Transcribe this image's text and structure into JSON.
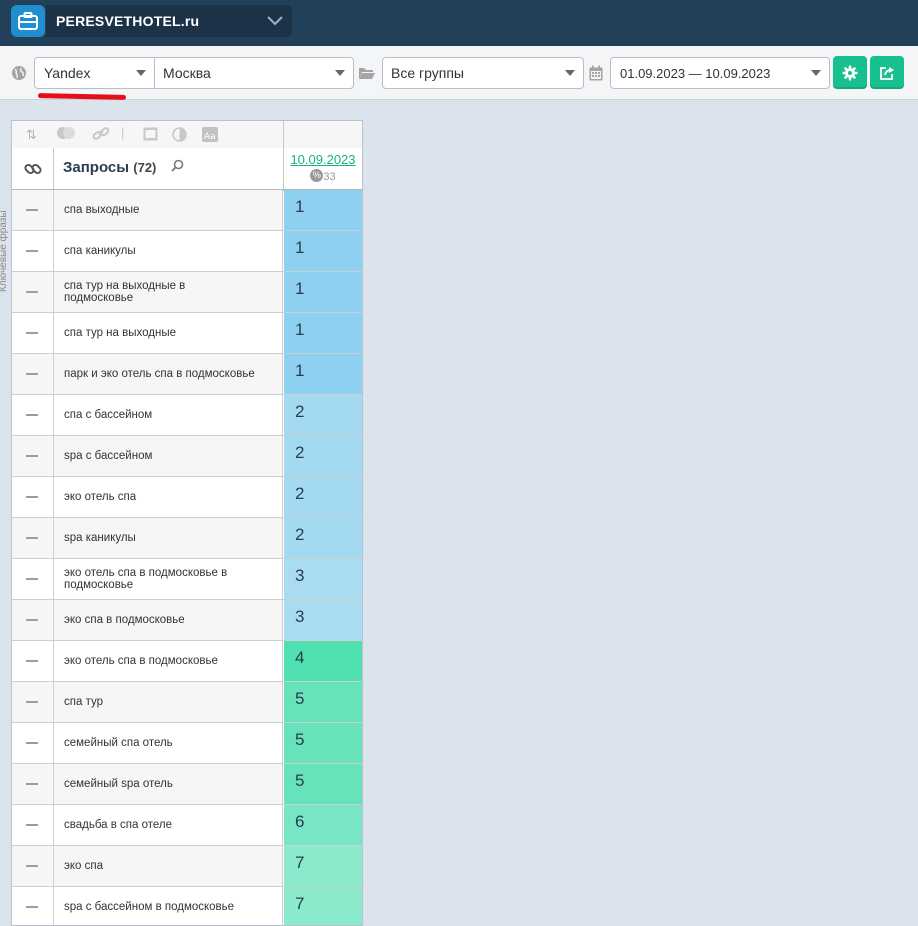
{
  "header": {
    "project_name": "PERESVETHOTEL.ru"
  },
  "filters": {
    "engine": "Yandex",
    "city": "Москва",
    "group": "Все группы",
    "date_range": "01.09.2023 — 10.09.2023"
  },
  "table": {
    "title": "Запросы",
    "count": "(72)",
    "side_label": "Ключевые фразы",
    "date_column": "10.09.2023",
    "date_meta": "33",
    "rows": [
      {
        "query": "спа выходные",
        "position": "1",
        "color": "#8dd0ef"
      },
      {
        "query": "спа каникулы",
        "position": "1",
        "color": "#8dd0ef"
      },
      {
        "query": "спа тур на выходные в подмосковье",
        "position": "1",
        "color": "#8dd0ef"
      },
      {
        "query": "спа тур на выходные",
        "position": "1",
        "color": "#8dd0ef"
      },
      {
        "query": "парк и эко отель спа в подмосковье",
        "position": "1",
        "color": "#8dd0ef"
      },
      {
        "query": "спа с бассейном",
        "position": "2",
        "color": "#a3daf2"
      },
      {
        "query": "spa с бассейном",
        "position": "2",
        "color": "#a3daf2"
      },
      {
        "query": "эко отель спа",
        "position": "2",
        "color": "#a3daf2"
      },
      {
        "query": "spa каникулы",
        "position": "2",
        "color": "#a3daf2"
      },
      {
        "query": "эко отель спа в подмосковье в подмосковье",
        "position": "3",
        "color": "#a9dcf1"
      },
      {
        "query": "эко спа в подмосковье",
        "position": "3",
        "color": "#a9dcf1"
      },
      {
        "query": "эко отель спа в подмосковье",
        "position": "4",
        "color": "#4fe0b2"
      },
      {
        "query": "спа тур",
        "position": "5",
        "color": "#66e3bb"
      },
      {
        "query": "семейный спа отель",
        "position": "5",
        "color": "#66e3bb"
      },
      {
        "query": "семейный spa отель",
        "position": "5",
        "color": "#66e3bb"
      },
      {
        "query": "свадьба в спа отеле",
        "position": "6",
        "color": "#78e6c4"
      },
      {
        "query": "эко спа",
        "position": "7",
        "color": "#8beacc"
      },
      {
        "query": "spa с бассейном в подмосковье",
        "position": "7",
        "color": "#8beacc"
      }
    ]
  }
}
